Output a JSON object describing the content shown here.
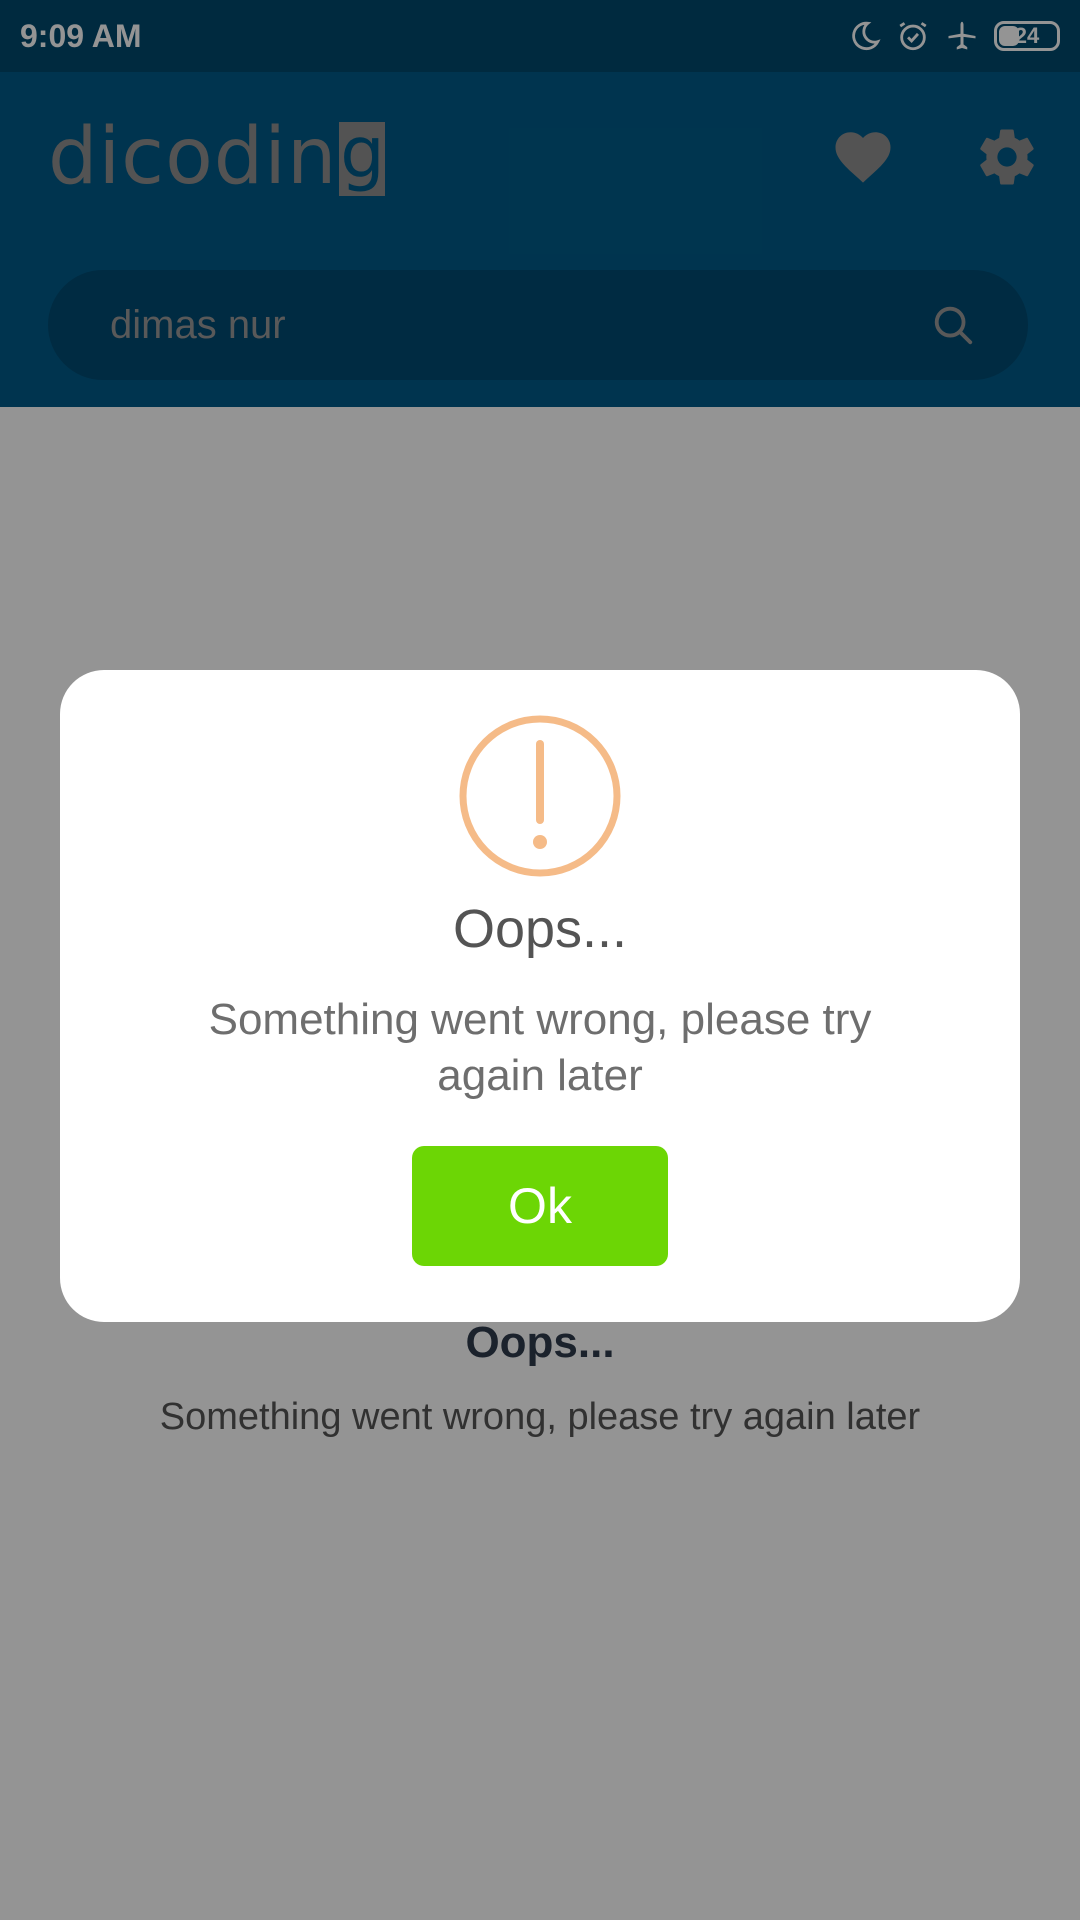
{
  "status_bar": {
    "time": "9:09 AM",
    "battery_level": "24",
    "icons": [
      "moon-icon",
      "alarm-icon",
      "airplane-icon",
      "battery-icon"
    ]
  },
  "app_bar": {
    "logo_text": "dicodin",
    "logo_box_letter": "g",
    "actions": [
      "heart-icon",
      "gear-icon"
    ]
  },
  "search": {
    "value": "dimas nur",
    "icon": "search-icon"
  },
  "background_error": {
    "title": "Oops...",
    "message": "Something went wrong, please try again later"
  },
  "dialog": {
    "icon": "warning-icon",
    "title": "Oops...",
    "message": "Something went wrong, please try again later",
    "ok_label": "Ok"
  },
  "colors": {
    "status_bar": "#00496d",
    "app_bar": "#005b88",
    "warning": "#f5bb88",
    "ok_button": "#6cd605"
  }
}
